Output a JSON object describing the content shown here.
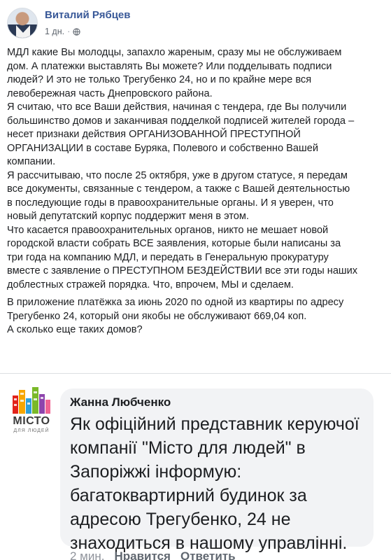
{
  "post": {
    "author": "Виталий Рябцев",
    "time": "1 дн.",
    "privacy_icon": "globe-icon",
    "paragraphs": [
      "МДЛ какие Вы молодцы, запахло жареным, сразу мы не обслуживаем\nдом. А платежки выставлять Вы можете? Или подделывать подписи\nлюдей? И это не только Трегубенко 24, но и по крайне мере вся\nлевобережная часть Днепровского района.",
      "Я считаю, что все Ваши действия, начиная с тендера, где Вы получили\nбольшинство домов и заканчивая подделкой подписей жителей города –\nнесет признаки действия ОРГАНИЗОВАННОЙ ПРЕСТУПНОЙ\nОРГАНИЗАЦИИ в составе Буряка, Полевого и собственно Вашей\nкомпании.",
      "Я рассчитываю, что после 25 октября, уже в другом статусе, я передам\nвсе документы, связанные с тендером, а также с Вашей деятельностью\nв последующие годы в правоохранительные органы. И я уверен, что\nновый депутатский корпус поддержит меня в этом.",
      "Что касается правоохранительных органов, никто не мешает новой\nгородской власти собрать ВСЕ заявления, которые были написаны за\nтри года на компанию МДЛ, и передать в Генеральную прокуратуру\nвместе с заявление о ПРЕСТУПНОМ БЕЗДЕЙСТВИИ все эти годы наших\nдоблестных стражей порядка. Что, впрочем, МЫ и сделаем.",
      "В приложение платёжка за июнь 2020 по одной из квартиры по адресу\nТрегубенко 24, который они якобы не обслуживают 669,04 коп.\nА сколько еще таких домов?"
    ]
  },
  "comment": {
    "logo_text": "МІСТО",
    "logo_sub": "ДЛЯ ЛЮДЕЙ",
    "author": "Жанна Любченко",
    "text": "Як офіційний представник керуючої компанії \"Місто для людей\" в Запоріжжі інформую: багатоквартирний будинок за адресою Трегубенко, 24 не знаходиться в нашому управлінні.",
    "time": "2 мин.",
    "like_label": "Нравится",
    "reply_label": "Ответить",
    "separator": "·"
  },
  "colors": {
    "author_link": "#385898",
    "bubble_bg": "#f2f3f5",
    "meta_text": "#606770"
  }
}
